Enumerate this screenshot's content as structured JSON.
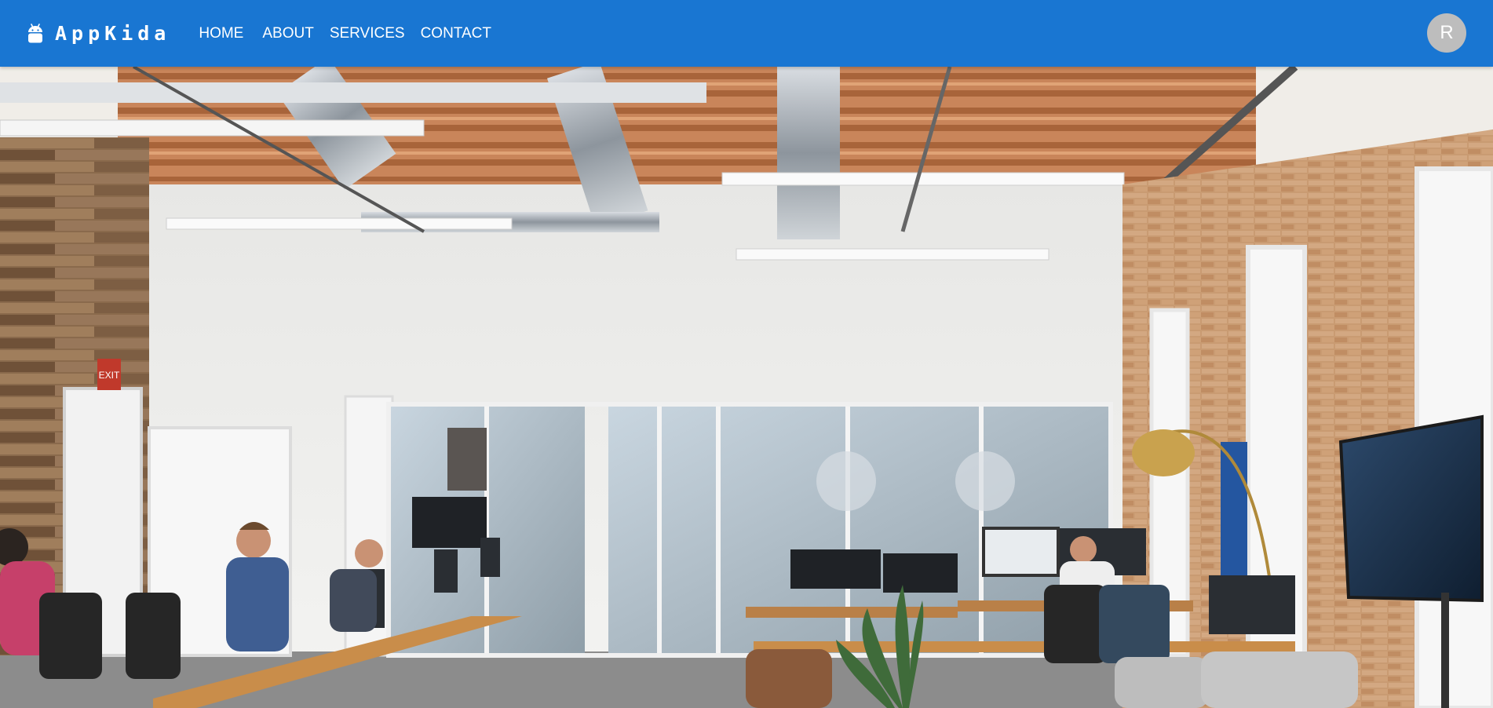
{
  "app": {
    "brand_name": "AppKida",
    "brand_icon": "android-icon",
    "brand_color": "#1976d2"
  },
  "nav": {
    "items": [
      {
        "label": "HOME"
      },
      {
        "label": "ABOUT"
      },
      {
        "label": "SERVICES"
      },
      {
        "label": "CONTACT"
      }
    ]
  },
  "user": {
    "avatar_letter": "R",
    "avatar_color": "#bdbdbd"
  },
  "hero": {
    "image": "open-plan office interior with people working at desks",
    "exit_sign": "EXIT"
  }
}
